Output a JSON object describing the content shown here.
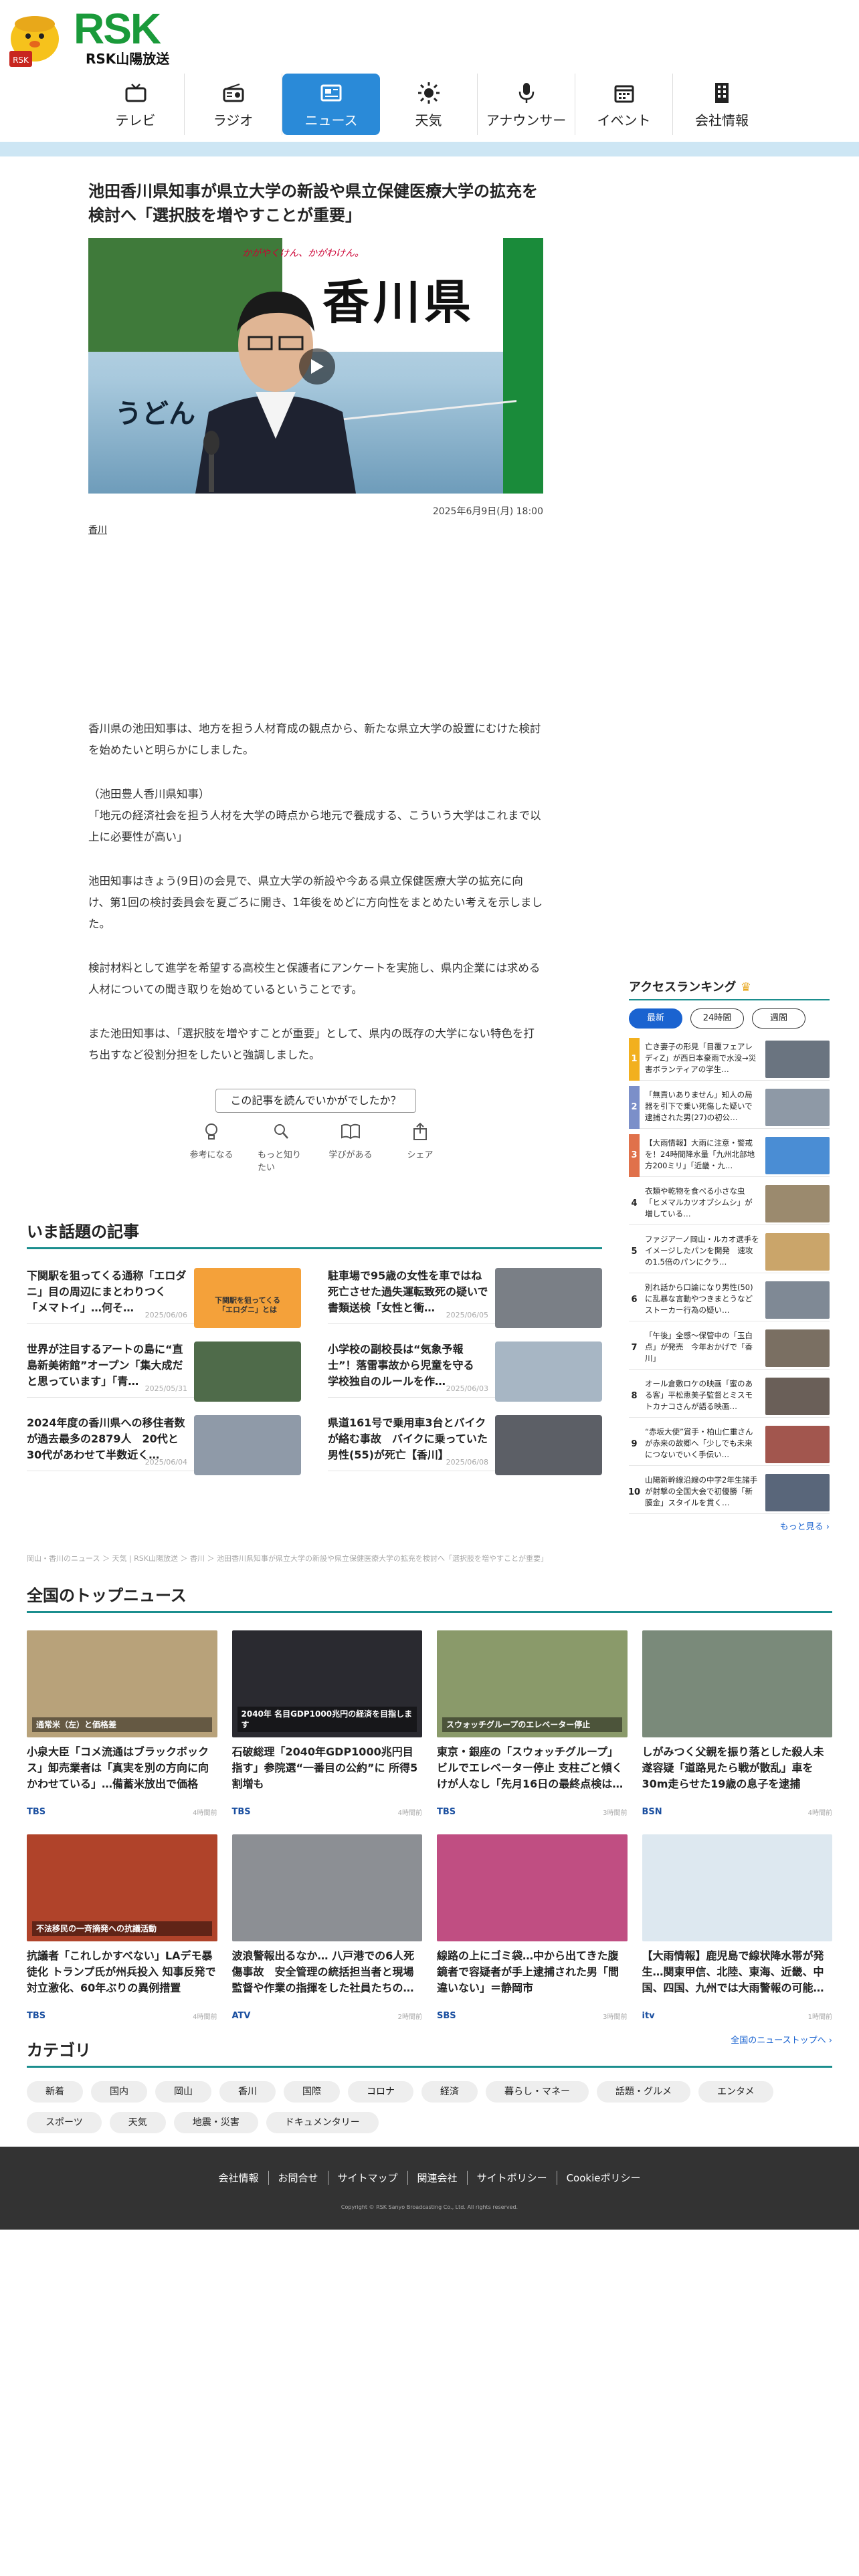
{
  "header": {
    "logo_text": "RSK",
    "logo_sub": "RSK山陽放送",
    "nav": [
      {
        "label": "テレビ",
        "icon": "tv-icon"
      },
      {
        "label": "ラジオ",
        "icon": "radio-icon"
      },
      {
        "label": "ニュース",
        "icon": "news-icon",
        "active": true
      },
      {
        "label": "天気",
        "icon": "sun-icon"
      },
      {
        "label": "アナウンサー",
        "icon": "microphone-icon"
      },
      {
        "label": "イベント",
        "icon": "calendar-icon"
      },
      {
        "label": "会社情報",
        "icon": "building-icon"
      }
    ]
  },
  "article": {
    "title": "池田香川県知事が県立大学の新設や県立保健医療大学の拡充を検討へ「選択肢を増やすことが重要」",
    "hero_sign": "香川県",
    "hero_udon": "うどん",
    "hero_caption": "かがやくけん、かがわけん。",
    "date": "2025年6月9日(月) 18:00",
    "tag": "香川",
    "paragraphs": [
      "香川県の池田知事は、地方を担う人材育成の観点から、新たな県立大学の設置にむけた検討を始めたいと明らかにしました。",
      "（池田豊人香川県知事）\n「地元の経済社会を担う人材を大学の時点から地元で養成する、こういう大学はこれまで以上に必要性が高い」",
      "池田知事はきょう(9日)の会見で、県立大学の新設や今ある県立保健医療大学の拡充に向け、第1回の検討委員会を夏ごろに開き、1年後をめどに方向性をまとめたい考えを示しました。",
      "検討材料として進学を希望する高校生と保護者にアンケートを実施し、県内企業には求める人材についての聞き取りを始めているということです。",
      "また池田知事は、「選択肢を増やすことが重要」として、県内の既存の大学にない特色を打ち出すなど役割分担をしたいと強調しました。"
    ],
    "reaction_question": "この記事を読んでいかがでしたか？",
    "reactions": [
      {
        "label": "参考になる",
        "icon": "lightbulb-icon"
      },
      {
        "label": "もっと知りたい",
        "icon": "magnifier-icon"
      },
      {
        "label": "学びがある",
        "icon": "book-icon"
      },
      {
        "label": "シェア",
        "icon": "share-icon"
      }
    ]
  },
  "trending": {
    "heading": "いま話題の記事",
    "items": [
      {
        "title": "下関駅を狙ってくる通称「エロダニ」目の周辺にまとわりつく「メマトイ」…何そ…",
        "date": "2025/06/06",
        "img_color": "#f4a13a",
        "img_text": "下関駅を狙ってくる\n「エロダニ」とは"
      },
      {
        "title": "駐車場で95歳の女性を車ではね死亡させた過失運転致死の疑いで書類送検「女性と衝…",
        "date": "2025/06/05",
        "img_color": "#7a7f86",
        "img_text": ""
      },
      {
        "title": "世界が注目するアートの島に“直島新美術館”オープン「集大成だと思っています」「青…",
        "date": "2025/05/31",
        "img_color": "#4f6b4a",
        "img_text": ""
      },
      {
        "title": "小学校の副校長は“気象予報士”！落雷事故から児童を守る　学校独自のルールを作…",
        "date": "2025/06/03",
        "img_color": "#a7b6c4",
        "img_text": ""
      },
      {
        "title": "2024年度の香川県への移住者数が過去最多の2879人　20代と30代があわせて半数近く…",
        "date": "2025/06/04",
        "img_color": "#8f9aa8",
        "img_text": ""
      },
      {
        "title": "県道161号で乗用車3台とバイクが絡む事故　バイクに乗っていた男性(55)が死亡【香川】",
        "date": "2025/06/08",
        "img_color": "#5c5f66",
        "img_text": ""
      }
    ]
  },
  "breadcrumb": "岡山・香川のニュース ＞ 天気 | RSK山陽放送 ＞ 香川 ＞ 池田香川県知事が県立大学の新設や県立保健医療大学の拡充を検討へ「選択肢を増やすことが重要」",
  "ranking": {
    "heading": "アクセスランキング",
    "tabs": [
      "最新",
      "24時間",
      "週間"
    ],
    "items": [
      {
        "rank": "1",
        "title": "亡き妻子の形見「目覆フェアレディZ」が西日本豪雨で水没→災害ボランティアの学生…",
        "color": "#f2b01e",
        "img_color": "#6a7480"
      },
      {
        "rank": "2",
        "title": "「無責いありません」知人の局器を引下で乗い死傷した疑いで逮捕された男(27)の初公…",
        "color": "#7b8fc9",
        "img_color": "#8e99a6"
      },
      {
        "rank": "3",
        "title": "【大雨情報】大雨に注意・警戒を！24時間降水量「九州北部地方200ミリ」「近畿・九…",
        "color": "#e0714b",
        "img_color": "#4a8dd4"
      },
      {
        "rank": "4",
        "title": "衣類や乾物を食べる小さな虫「ヒメマルカツオブシムシ」が増している…",
        "color": "",
        "img_color": "#9b8a6e"
      },
      {
        "rank": "5",
        "title": "ファジアーノ岡山・ルカオ選手をイメージしたパンを開発　速攻の1.5倍のパンにクラ…",
        "color": "",
        "img_color": "#caa56a"
      },
      {
        "rank": "6",
        "title": "別れ話から口論になり男性(50)に乱暴な言動やつきまとうなどストーカー行為の疑い…",
        "color": "",
        "img_color": "#7f8995"
      },
      {
        "rank": "7",
        "title": "「午後」全感～保管中の「玉白点」が発売　今年おかげで「香川」",
        "color": "",
        "img_color": "#7a6f62"
      },
      {
        "rank": "8",
        "title": "オール倉敷ロケの映画「蜜のある客」平松恵美子監督とミスモトカナコさんが語る映画…",
        "color": "",
        "img_color": "#6a5f58"
      },
      {
        "rank": "9",
        "title": "“赤坂大使”賞手・柏山仁重さんが赤来の故郷へ「少しでも未来につないでいく手伝い…",
        "color": "",
        "img_color": "#a2564e"
      },
      {
        "rank": "10",
        "title": "山陽新幹線沿線の中学2年生諸手が射撃の全国大会で初優勝「新膜金」スタイルを貫く…",
        "color": "",
        "img_color": "#59667a"
      }
    ],
    "more": "もっと見る"
  },
  "topnews": {
    "heading": "全国のトップニュース",
    "items": [
      {
        "title": "小泉大臣「コメ流通はブラックボックス」卸売業者は「真実を別の方向に向かわせている」…備蓄米放出で価格ど…",
        "src": "TBS",
        "time": "4時間前",
        "img_color": "#b8a27a",
        "badge": "通常米（左）と価格差"
      },
      {
        "title": "石破総理「2040年GDP1000兆円目指す」参院選“一番目の公約”に 所得5割増も",
        "src": "TBS",
        "time": "4時間前",
        "img_color": "#2a2a30",
        "badge": "2040年 名目GDP1000兆円の経済を目指します"
      },
      {
        "title": "東京・銀座の「スウォッチグループ」ビルでエレベーター停止 支柱ごと傾くけが人なし「先月16日の最終点検は…",
        "src": "TBS",
        "time": "3時間前",
        "img_color": "#8a9a6a",
        "badge": "スウォッチグループのエレベーター停止"
      },
      {
        "title": "しがみつく父親を振り落とした殺人未遂容疑「道路見たら戦が散乱」車を30m走らせた19歳の息子を逮捕　新…",
        "src": "BSN",
        "time": "4時間前",
        "img_color": "#7a8a7a",
        "badge": ""
      },
      {
        "title": "抗議者「これしかすべない」LAデモ暴徒化 トランプ氏が州兵投入 知事反発で対立激化、60年ぶりの異例措置",
        "src": "TBS",
        "time": "4時間前",
        "img_color": "#b0432a",
        "badge": "不法移民の一斉摘発への抗議活動"
      },
      {
        "title": "波浪警報出るなか… 八戸港での6人死傷事故　安全管理の統括担当者と現場監督や作業の指揮をした社員たちの…",
        "src": "ATV",
        "time": "2時間前",
        "img_color": "#8c8f94",
        "badge": ""
      },
      {
        "title": "線路の上にゴミ袋…中から出てきた腹鏡者で容疑者が手上逮捕された男「間違いない」＝静岡市",
        "src": "SBS",
        "time": "3時間前",
        "img_color": "#c04e82",
        "badge": ""
      },
      {
        "title": "【大雨情報】鹿児島で線状降水帯が発生…関東甲信、北陸、東海、近畿、中国、四国、九州では大雨警報の可能…",
        "src": "itv",
        "time": "1時間前",
        "img_color": "#dde8f0",
        "badge": ""
      }
    ],
    "more": "全国のニューストップへ"
  },
  "categories": {
    "heading": "カテゴリ",
    "items": [
      "新着",
      "国内",
      "岡山",
      "香川",
      "国際",
      "コロナ",
      "経済",
      "暮らし・マネー",
      "話題・グルメ",
      "エンタメ",
      "スポーツ",
      "天気",
      "地震・災害",
      "ドキュメンタリー"
    ]
  },
  "footer": {
    "links": [
      "会社情報",
      "お問合せ",
      "サイトマップ",
      "関連会社",
      "サイトポリシー",
      "Cookieポリシー"
    ],
    "copyright": "Copyright © RSK Sanyo Broadcasting Co., Ltd. All rights reserved."
  }
}
